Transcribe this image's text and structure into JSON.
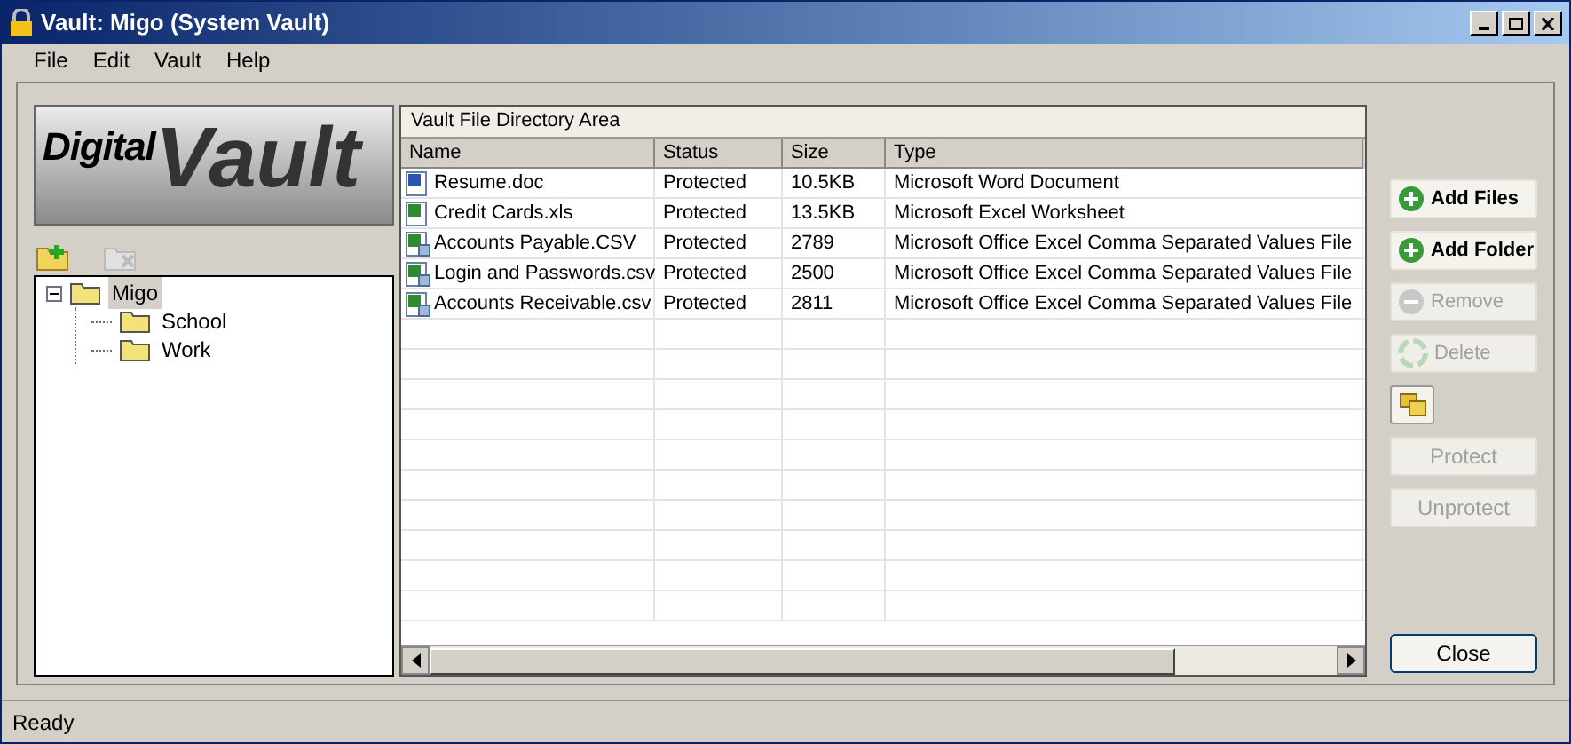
{
  "window": {
    "title": "Vault: Migo (System Vault)"
  },
  "menu": [
    "File",
    "Edit",
    "Vault",
    "Help"
  ],
  "logo": {
    "word_1": "Digital",
    "word_2": "Vault"
  },
  "tree_toolbar": [
    {
      "kind": "add-folder",
      "disabled": false
    },
    {
      "kind": "remove-folder",
      "disabled": true
    }
  ],
  "tree": [
    {
      "label": "Migo",
      "selected": true,
      "expanded": true,
      "children": [
        {
          "label": "School",
          "selected": false
        },
        {
          "label": "Work",
          "selected": false
        }
      ]
    }
  ],
  "table": {
    "title": "Vault File Directory Area",
    "columns": [
      "Name",
      "Status",
      "Size",
      "Type"
    ],
    "rows": [
      {
        "kind": "word",
        "cells": [
          "Resume.doc",
          "Protected",
          "10.5KB",
          "Microsoft Word Document"
        ]
      },
      {
        "kind": "excel",
        "cells": [
          "Credit Cards.xls",
          "Protected",
          "13.5KB",
          "Microsoft Excel Worksheet"
        ]
      },
      {
        "kind": "csv",
        "cells": [
          "Accounts Payable.CSV",
          "Protected",
          "2789",
          "Microsoft Office Excel Comma Separated Values File"
        ]
      },
      {
        "kind": "csv",
        "cells": [
          "Login and Passwords.csv",
          "Protected",
          "2500",
          "Microsoft Office Excel Comma Separated Values File"
        ]
      },
      {
        "kind": "csv",
        "cells": [
          "Accounts Receivable.csv",
          "Protected",
          "2811",
          "Microsoft Office Excel Comma Separated Values File"
        ]
      }
    ]
  },
  "actions": [
    {
      "kind": "add",
      "label": "Add Files",
      "disabled": false
    },
    {
      "kind": "add",
      "label": "Add Folder",
      "disabled": false
    },
    {
      "kind": "remove",
      "label": "Remove",
      "disabled": true
    },
    {
      "kind": "delete",
      "label": "Delete",
      "disabled": true
    },
    {
      "kind": "folders",
      "disabled": false
    },
    {
      "kind": "text",
      "label": "Protect",
      "disabled": true
    },
    {
      "kind": "text",
      "label": "Unprotect",
      "disabled": true
    }
  ],
  "close_button": "Close",
  "status_bar": "Ready"
}
